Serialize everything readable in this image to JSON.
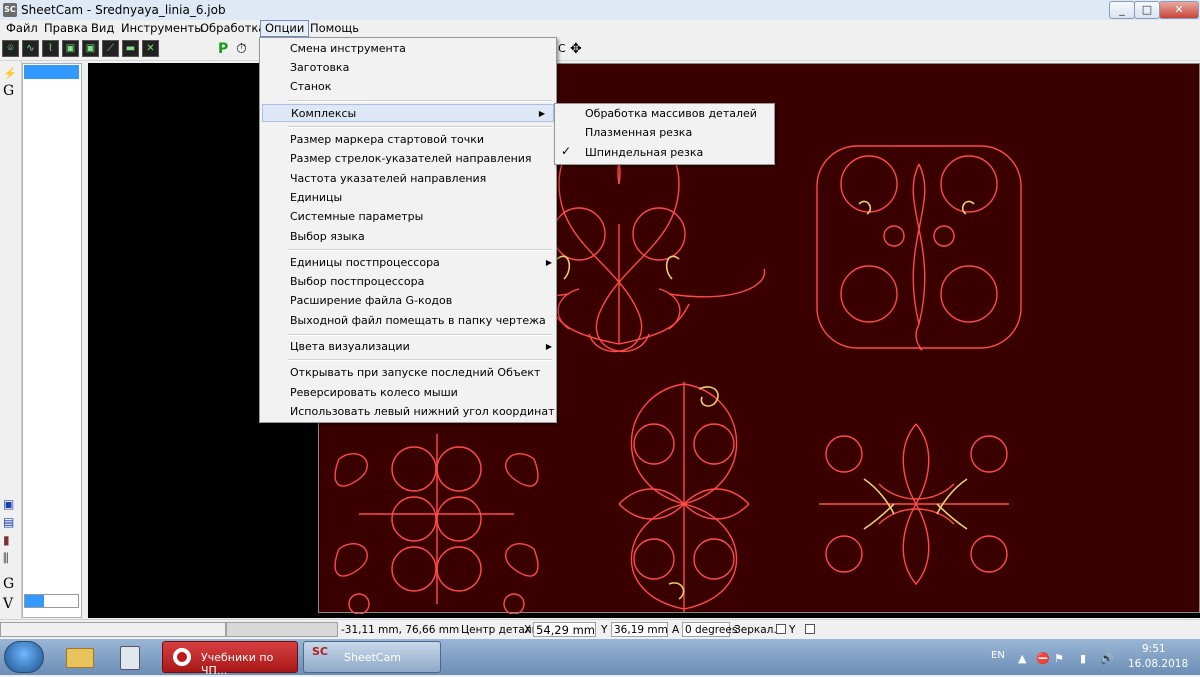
{
  "window": {
    "title": "SheetCam - Srednyaya_linia_6.job",
    "app_icon": "SC"
  },
  "menubar": {
    "items": [
      "Файл",
      "Правка",
      "Вид",
      "Инструменты",
      "Обработка",
      "Опции",
      "Помощь"
    ],
    "open_item": "Опции"
  },
  "options_menu": {
    "items": [
      {
        "label": "Смена инструмента"
      },
      {
        "label": "Заготовка"
      },
      {
        "label": "Станок"
      },
      {
        "label": "Комплексы",
        "has_submenu": true,
        "highlighted": true
      },
      {
        "label": "Размер маркера стартовой точки"
      },
      {
        "label": "Размер стрелок-указателей направления"
      },
      {
        "label": "Частота указателей направления"
      },
      {
        "label": "Единицы"
      },
      {
        "label": "Системные параметры"
      },
      {
        "label": "Выбор языка"
      },
      {
        "label": "Единицы постпроцессора",
        "has_submenu": true
      },
      {
        "label": "Выбор постпроцессора"
      },
      {
        "label": "Расширение файла G-кодов"
      },
      {
        "label": "Выходной файл помещать в папку чертежа"
      },
      {
        "label": "Цвета визуализации",
        "has_submenu": true
      },
      {
        "label": "Открывать при запуске последний Объект"
      },
      {
        "label": "Реверсировать колесо мыши"
      },
      {
        "label": "Использовать левый нижний угол координат"
      }
    ]
  },
  "complexes_submenu": {
    "items": [
      {
        "label": "Обработка массивов деталей",
        "checked": false
      },
      {
        "label": "Плазменная резка",
        "checked": false
      },
      {
        "label": "Шпиндельная резка",
        "checked": true
      }
    ]
  },
  "toolbar": {
    "post_label": "P",
    "toolbar_c": "C"
  },
  "left_strip": {
    "top_icons": [
      "G"
    ],
    "bottom_icons": [
      "G",
      "V"
    ]
  },
  "tree_panel": {
    "progress_fraction": 0.35
  },
  "statusbar": {
    "cursor_coords": "-31,11 mm, 76,66 mm",
    "part_center_label": "Центр детали:",
    "x_label": "X",
    "x_value": "54,29 mm",
    "y_label": "Y",
    "y_value": "36,19 mm",
    "a_label": "A",
    "a_value": "0 degrees",
    "mirror_label": "Зеркал.X",
    "mirror_y_label": "Y"
  },
  "taskbar": {
    "apps": [
      {
        "label": "Учебники по ЧП...",
        "icon": "opera-icon"
      },
      {
        "label": "SheetCam",
        "icon": "sheetcam-icon"
      }
    ],
    "language": "EN",
    "time": "9:51",
    "date": "16.08.2018"
  },
  "colors": {
    "sheet": "#3a0000",
    "part_outline": "#ff4040",
    "highlight_menu": "#dde7f5",
    "selection": "#3399ff"
  }
}
